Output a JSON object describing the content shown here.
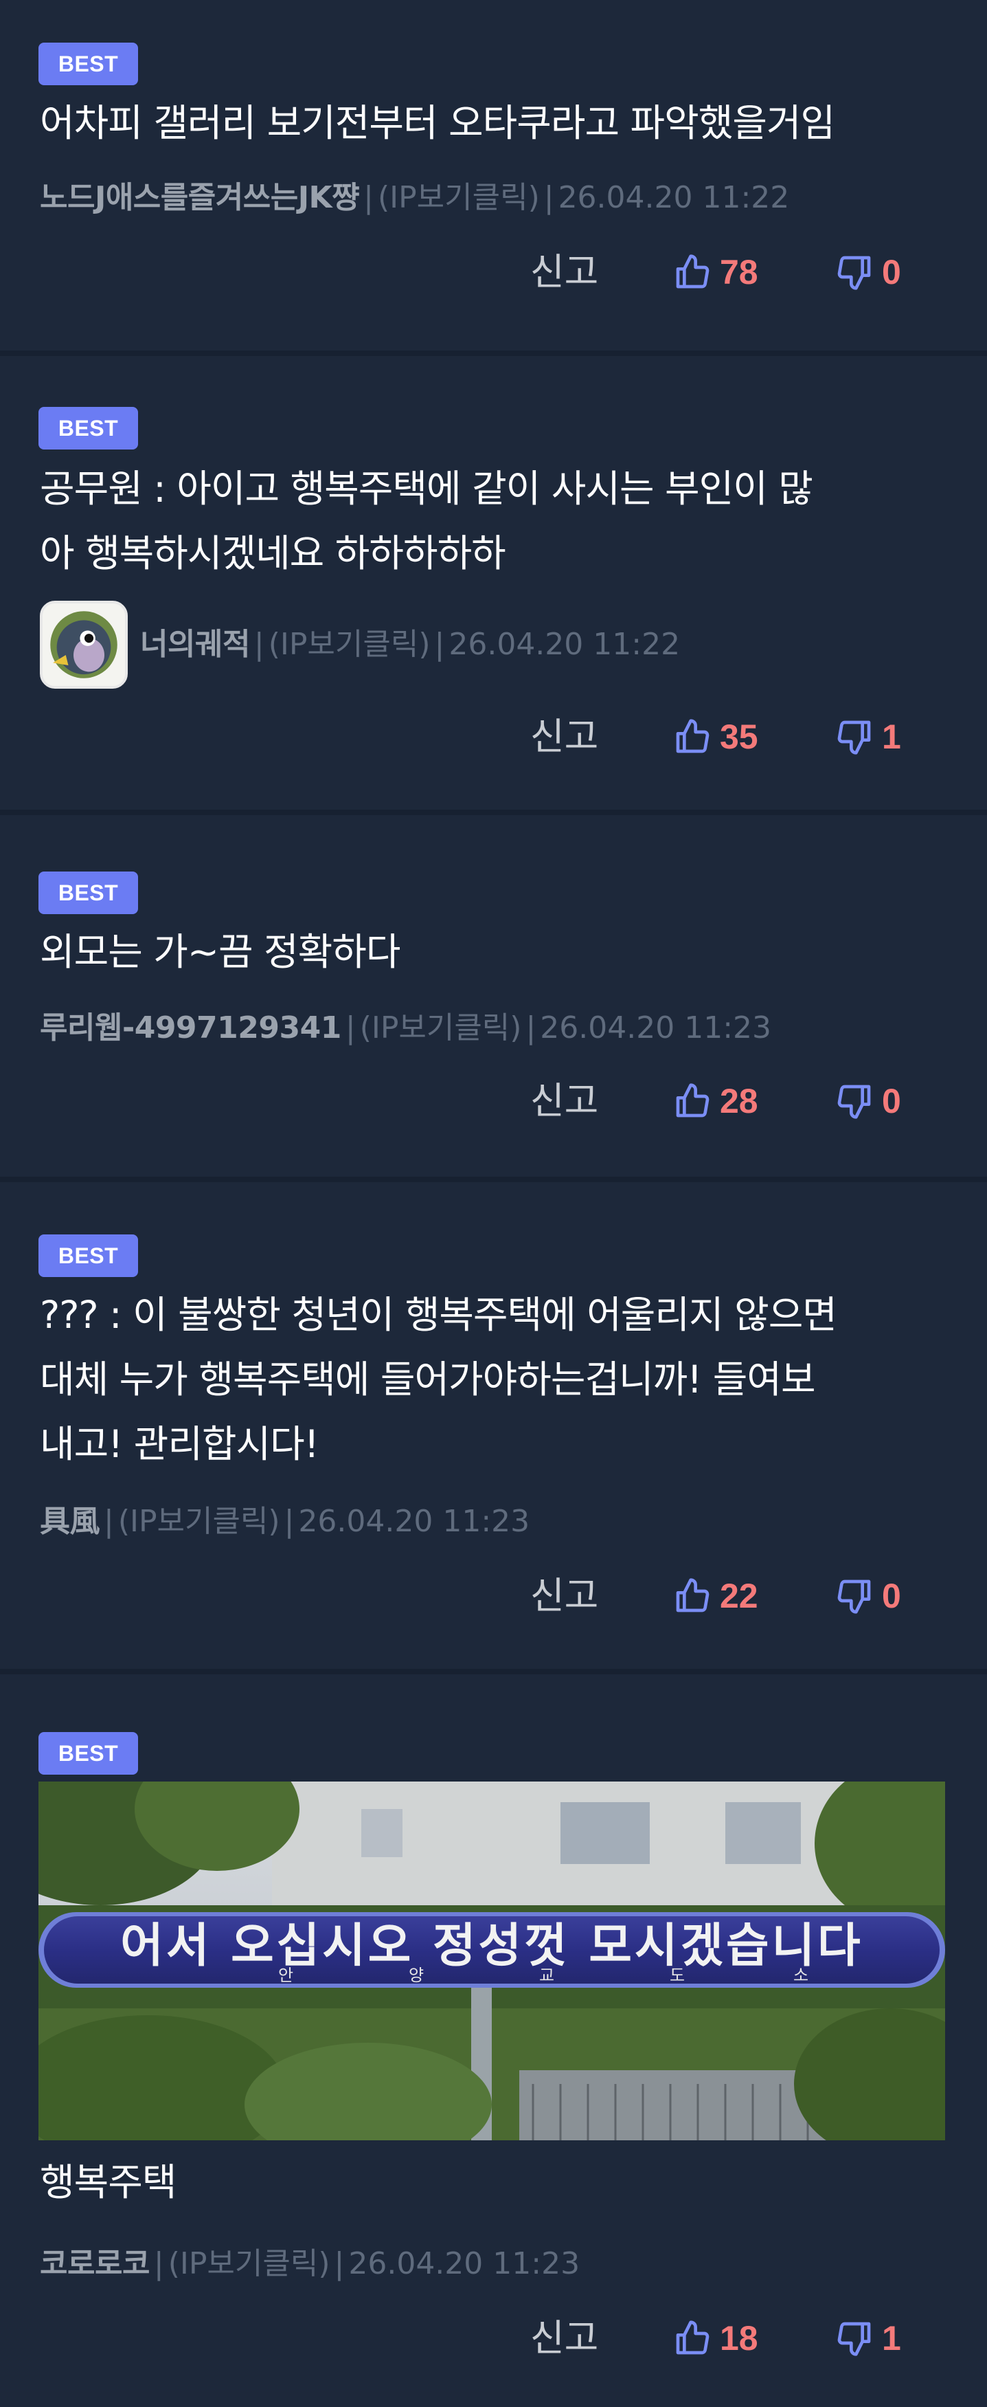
{
  "colors": {
    "background": "#1d283a",
    "best_badge": "#6b7cf3",
    "vote_count": "#f47a7a",
    "thumb_icon": "#7b8ef5",
    "nickname": "#9aa2ad",
    "meta_text": "#5f6b7d"
  },
  "comments": [
    {
      "badge": "BEST",
      "text": "어차피 갤러리 보기전부터 오타쿠라고 파악했을거임",
      "nickname": "노드J애스를즐겨쓰는JK쨩",
      "ip": "(IP보기클릭)",
      "datetime": "26.04.20 11:22",
      "report": "신고",
      "likes": "78",
      "dislikes": "0"
    },
    {
      "badge": "BEST",
      "text": "공무원 : 아이고 행복주택에 같이 사시는 부인이 많\n아 행복하시겠네요 하하하하하",
      "nickname": "너의궤적",
      "avatar_icon": "penguin-avatar-icon",
      "ip": "(IP보기클릭)",
      "datetime": "26.04.20 11:22",
      "report": "신고",
      "likes": "35",
      "dislikes": "1"
    },
    {
      "badge": "BEST",
      "text": "외모는 가~끔 정확하다",
      "nickname": "루리웹-4997129341",
      "ip": "(IP보기클릭)",
      "datetime": "26.04.20 11:23",
      "report": "신고",
      "likes": "28",
      "dislikes": "0"
    },
    {
      "badge": "BEST",
      "text": "??? : 이 불쌍한 청년이 행복주택에 어울리지 않으면\n대체 누가 행복주택에 들어가야하는겁니까! 들여보\n내고! 관리합시다!",
      "nickname": "具風",
      "ip": "(IP보기클릭)",
      "datetime": "26.04.20 11:23",
      "report": "신고",
      "likes": "22",
      "dislikes": "0"
    },
    {
      "badge": "BEST",
      "image": {
        "banner_text": "어서 오십시오 정성껏 모시겠습니다",
        "sub_text": [
          "안",
          "양",
          "교",
          "도",
          "소"
        ]
      },
      "text": "행복주택",
      "nickname": "코로로코",
      "ip": "(IP보기클릭)",
      "datetime": "26.04.20 11:23",
      "report": "신고",
      "likes": "18",
      "dislikes": "1"
    }
  ]
}
